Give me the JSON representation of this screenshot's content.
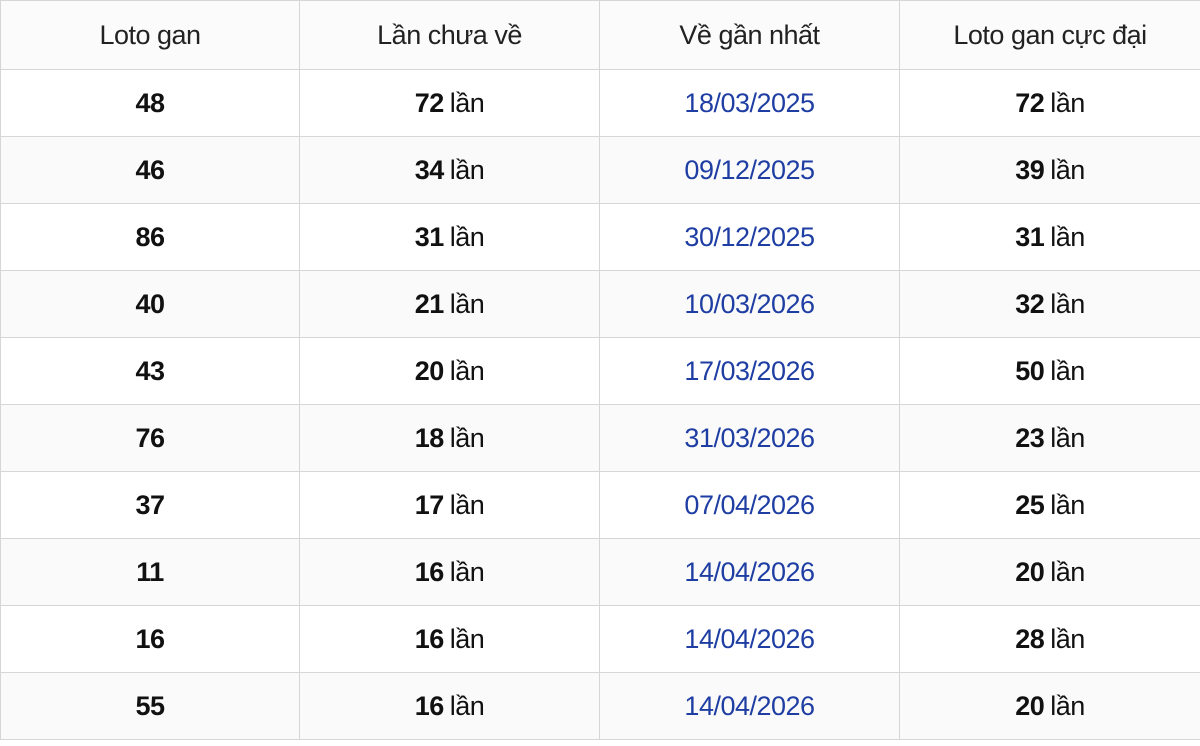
{
  "table": {
    "headers": [
      "Loto gan",
      "Lần chưa về",
      "Về gần nhất",
      "Loto gan cực đại"
    ],
    "unit": "lần",
    "rows": [
      {
        "loto": "48",
        "missing": "72",
        "last": "18/03/2025",
        "max": "72"
      },
      {
        "loto": "46",
        "missing": "34",
        "last": "09/12/2025",
        "max": "39"
      },
      {
        "loto": "86",
        "missing": "31",
        "last": "30/12/2025",
        "max": "31"
      },
      {
        "loto": "40",
        "missing": "21",
        "last": "10/03/2026",
        "max": "32"
      },
      {
        "loto": "43",
        "missing": "20",
        "last": "17/03/2026",
        "max": "50"
      },
      {
        "loto": "76",
        "missing": "18",
        "last": "31/03/2026",
        "max": "23"
      },
      {
        "loto": "37",
        "missing": "17",
        "last": "07/04/2026",
        "max": "25"
      },
      {
        "loto": "11",
        "missing": "16",
        "last": "14/04/2026",
        "max": "20"
      },
      {
        "loto": "16",
        "missing": "16",
        "last": "14/04/2026",
        "max": "28"
      },
      {
        "loto": "55",
        "missing": "16",
        "last": "14/04/2026",
        "max": "20"
      }
    ]
  },
  "colors": {
    "date_text": "#1f3ea3",
    "border": "#d6d6d6",
    "header_bg": "#fbfbfb"
  }
}
